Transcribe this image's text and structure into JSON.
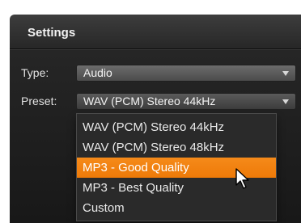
{
  "settings": {
    "title": "Settings",
    "type": {
      "label": "Type:",
      "value": "Audio"
    },
    "preset": {
      "label": "Preset:",
      "value": "WAV (PCM) Stereo 44kHz",
      "options": [
        "WAV (PCM) Stereo 44kHz",
        "WAV (PCM) Stereo 48kHz",
        "MP3 - Good Quality",
        "MP3 - Best Quality",
        "Custom"
      ],
      "highlighted_option": "MP3 - Good Quality"
    }
  },
  "colors": {
    "highlight": "#f28411",
    "panel": "#262626"
  },
  "icons": [
    "chevron-down-icon",
    "mouse-pointer-icon"
  ]
}
